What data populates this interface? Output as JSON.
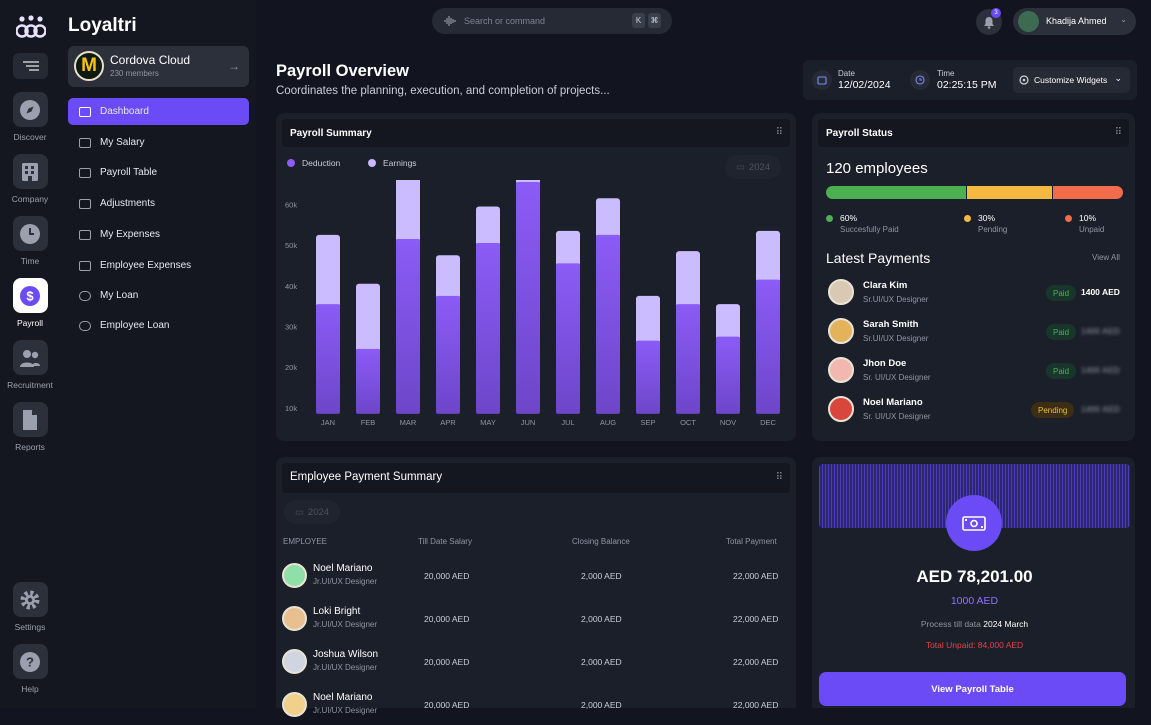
{
  "app": {
    "brand": "Loyaltri"
  },
  "rail": {
    "items": [
      {
        "label": "Discover",
        "icon": "compass-icon"
      },
      {
        "label": "Company",
        "icon": "building-icon"
      },
      {
        "label": "Time",
        "icon": "clock-icon"
      },
      {
        "label": "Payroll",
        "icon": "dollar-icon"
      },
      {
        "label": "Recruitment",
        "icon": "people-icon"
      },
      {
        "label": "Reports",
        "icon": "document-icon"
      },
      {
        "label": "Settings",
        "icon": "gear-icon"
      },
      {
        "label": "Help",
        "icon": "question-icon"
      }
    ],
    "active": "Payroll"
  },
  "org": {
    "name": "Cordova Cloud",
    "members": "230 members",
    "logo_letter": "M"
  },
  "nav": {
    "items": [
      {
        "label": "Dashboard"
      },
      {
        "label": "My Salary"
      },
      {
        "label": "Payroll Table"
      },
      {
        "label": "Adjustments"
      },
      {
        "label": "My Expenses"
      },
      {
        "label": "Employee Expenses"
      },
      {
        "label": "My Loan"
      },
      {
        "label": "Employee Loan"
      }
    ],
    "active": "Dashboard"
  },
  "topbar": {
    "search_placeholder": "Search or command",
    "shortcut_keys": [
      "K",
      "⌘"
    ],
    "notification_count": "3",
    "user_name": "Khadija Ahmed"
  },
  "header": {
    "title": "Payroll Overview",
    "subtitle": "Coordinates the planning, execution, and completion of projects...",
    "date_label": "Date",
    "date_value": "12/02/2024",
    "time_label": "Time",
    "time_value": "02:25:15 PM",
    "customize_label": "Customize Widgets"
  },
  "payroll_summary": {
    "title": "Payroll Summary",
    "year": "2024",
    "legend": [
      {
        "name": "Deduction",
        "color": "#8b5cf6"
      },
      {
        "name": "Earnings",
        "color": "#c9b8ff"
      }
    ]
  },
  "chart_data": {
    "type": "bar",
    "stacked": true,
    "title": "Payroll Summary",
    "categories": [
      "JAN",
      "FEB",
      "MAR",
      "APR",
      "MAY",
      "JUN",
      "JUL",
      "AUG",
      "SEP",
      "OCT",
      "NOV",
      "DEC"
    ],
    "series": [
      {
        "name": "Deduction",
        "values": [
          27,
          16,
          43,
          29,
          42,
          57,
          37,
          44,
          18,
          27,
          19,
          33
        ]
      },
      {
        "name": "Earnings",
        "values": [
          17,
          16,
          18,
          10,
          9,
          10,
          8,
          9,
          11,
          13,
          8,
          12
        ]
      }
    ],
    "y_ticks": [
      "10k",
      "20k",
      "30k",
      "40k",
      "50k",
      "60k"
    ],
    "ylabel_unit": "k",
    "ylim": [
      7,
      66
    ],
    "grid": false,
    "legend_position": "top-left"
  },
  "payroll_status": {
    "title": "Payroll Status",
    "count": "120 employees",
    "segments": [
      {
        "pct": "60%",
        "label": "Succesfully Paid",
        "color": "#4caf50",
        "fraction": 0.47
      },
      {
        "pct": "30%",
        "label": "Pending",
        "color": "#f5b942",
        "fraction": 0.29
      },
      {
        "pct": "10%",
        "label": "Unpaid",
        "color": "#f26b4b",
        "fraction": 0.24
      }
    ]
  },
  "latest_payments": {
    "title": "Latest Payments",
    "view_all": "View All",
    "rows": [
      {
        "name": "Clara Kim",
        "role": "Sr.UI/UX Designer",
        "status": "Paid",
        "amount": "1400 AED"
      },
      {
        "name": "Sarah Smith",
        "role": "Sr.UI/UX Designer",
        "status": "Paid",
        "amount": "1400 AED"
      },
      {
        "name": "Jhon Doe",
        "role": "Sr. UI/UX Designer",
        "status": "Paid",
        "amount": "1400 AED"
      },
      {
        "name": "Noel Mariano",
        "role": "Sr. UI/UX Designer",
        "status": "Pending",
        "amount": "1400 AED"
      }
    ]
  },
  "employee_payment_summary": {
    "title": "Employee Payment Summary",
    "year": "2024",
    "columns": [
      "EMPLOYEE",
      "Till Date Salary",
      "Closing Balance",
      "Total Payment"
    ],
    "rows": [
      {
        "name": "Noel Mariano",
        "role": "Jr.UI/UX Designer",
        "salary": "20,000 AED",
        "balance": "2,000 AED",
        "total": "22,000 AED"
      },
      {
        "name": "Loki Bright",
        "role": "Jr.UI/UX Designer",
        "salary": "20,000 AED",
        "balance": "2,000 AED",
        "total": "22,000 AED"
      },
      {
        "name": "Joshua Wilson",
        "role": "Jr.UI/UX Designer",
        "salary": "20,000 AED",
        "balance": "2,000 AED",
        "total": "22,000 AED"
      },
      {
        "name": "Noel Mariano",
        "role": "Jr.UI/UX Designer",
        "salary": "20,000 AED",
        "balance": "2,000 AED",
        "total": "22,000 AED"
      }
    ]
  },
  "wallet": {
    "total": "AED 78,201.00",
    "sub": "1000 AED",
    "process_prefix": "Process till data",
    "process_period": "2024 March",
    "unpaid": "Total Unpaid: 84,000 AED",
    "cta": "View Payroll Table"
  }
}
